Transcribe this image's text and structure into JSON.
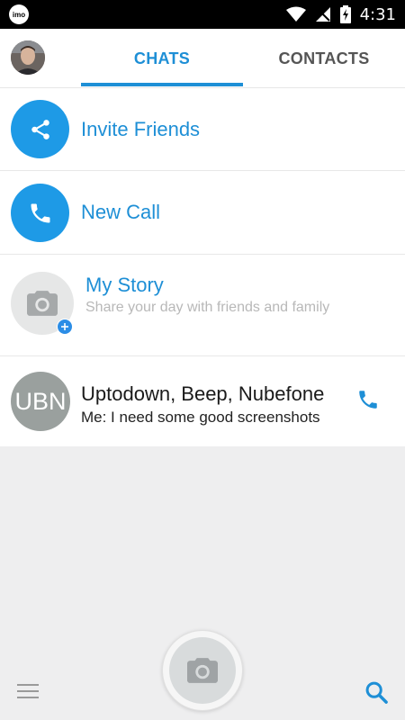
{
  "status_bar": {
    "app_badge": "imo",
    "time": "4:31"
  },
  "tabs": [
    {
      "label": "CHATS",
      "active": true
    },
    {
      "label": "CONTACTS",
      "active": false
    }
  ],
  "actions": {
    "invite": {
      "label": "Invite Friends",
      "icon": "share-icon"
    },
    "new_call": {
      "label": "New Call",
      "icon": "phone-icon"
    }
  },
  "story": {
    "title": "My Story",
    "subtitle": "Share your day with friends and family",
    "icon": "camera-icon"
  },
  "chats": [
    {
      "avatar_initials": "UBN",
      "title": "Uptodown, Beep, Nubefone",
      "last_message": "Me: I need some good screenshots",
      "action_icon": "phone-icon"
    }
  ],
  "colors": {
    "accent": "#1e8fd6",
    "circle_blue": "#1e9ae6",
    "background": "#eeeeef"
  }
}
